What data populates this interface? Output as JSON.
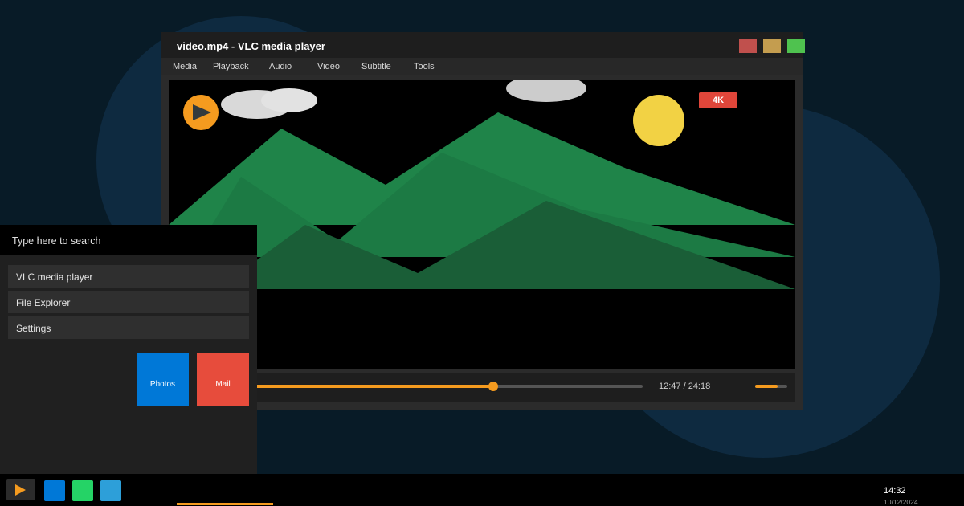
{
  "window": {
    "title": "video.mp4 - VLC media player",
    "controls": {
      "close_color": "#c0504d",
      "maximize_color": "#c49d4f",
      "minimize_color": "#4fc24f"
    }
  },
  "menu": {
    "items": [
      "Media",
      "Playback",
      "Audio",
      "Video",
      "Subtitle",
      "Tools"
    ]
  },
  "video": {
    "badge": "4K",
    "logo_icon": "vlc-play-icon"
  },
  "playback": {
    "current_time": "12:47",
    "total_time": "24:18",
    "time_text": "12:47 / 24:18",
    "progress_fraction": 0.62,
    "volume_fraction": 0.7,
    "accent_color": "#f59b1f"
  },
  "start_menu": {
    "search_placeholder": "Type here to search",
    "apps": [
      "VLC media player",
      "File Explorer",
      "Settings"
    ],
    "tiles": [
      {
        "label": "Photos",
        "color": "#0078d7"
      },
      {
        "label": "Mail",
        "color": "#e74c3c"
      }
    ]
  },
  "taskbar": {
    "pinned": [
      {
        "icon": "vlc-icon"
      },
      {
        "icon": "app-blue-icon",
        "color": "#0078d7"
      },
      {
        "icon": "app-green-icon",
        "color": "#25d366"
      },
      {
        "icon": "app-lightblue-icon",
        "color": "#2d9fd9"
      }
    ],
    "clock_time": "14:32",
    "clock_date": "10/12/2024"
  }
}
